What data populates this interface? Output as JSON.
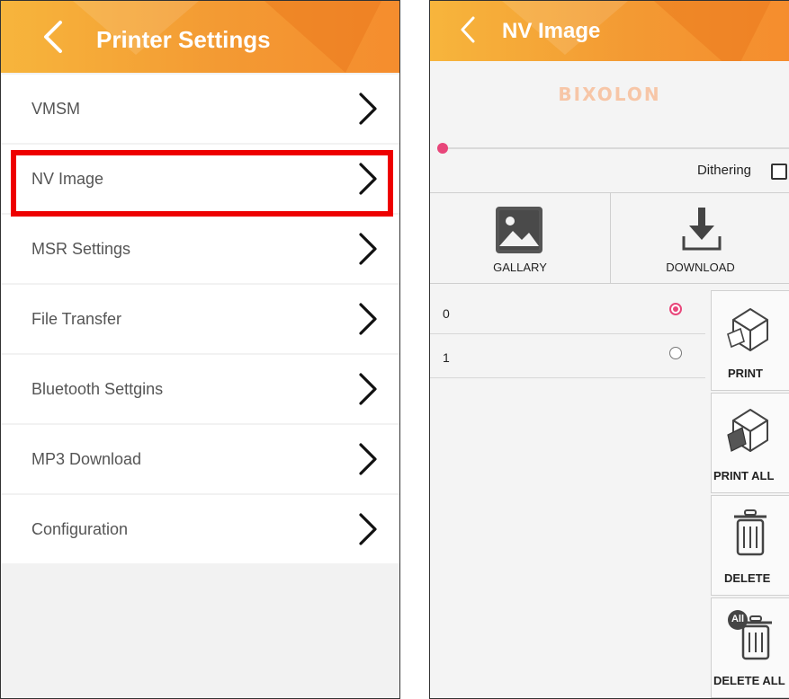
{
  "left_screen": {
    "title": "Printer Settings",
    "menu_items": [
      {
        "label": "VMSM"
      },
      {
        "label": "NV Image"
      },
      {
        "label": "MSR Settings"
      },
      {
        "label": "File Transfer"
      },
      {
        "label": "Bluetooth Settgins"
      },
      {
        "label": "MP3 Download"
      },
      {
        "label": "Configuration"
      }
    ],
    "highlighted_item": "NV Image"
  },
  "right_screen": {
    "title": "NV Image",
    "logo_text": "BIXOLON",
    "dithering_label": "Dithering",
    "dithering_checked": false,
    "slider_value": 0,
    "tools": {
      "gallery_label": "GALLARY",
      "download_label": "DOWNLOAD"
    },
    "images": [
      {
        "index": "0",
        "selected": true
      },
      {
        "index": "1",
        "selected": false
      }
    ],
    "actions": {
      "print_label": "PRINT",
      "print_all_label": "PRINT ALL",
      "delete_label": "DELETE",
      "delete_all_label": "DELETE ALL",
      "all_badge": "All"
    }
  },
  "colors": {
    "appbar_orange": "#f39a33",
    "highlight_red": "#ee0000",
    "accent_pink": "#e8467a"
  },
  "icons": [
    "back-arrow-icon",
    "chevron-right-icon",
    "gallery-image-icon",
    "download-icon",
    "printer-icon",
    "trash-icon"
  ]
}
